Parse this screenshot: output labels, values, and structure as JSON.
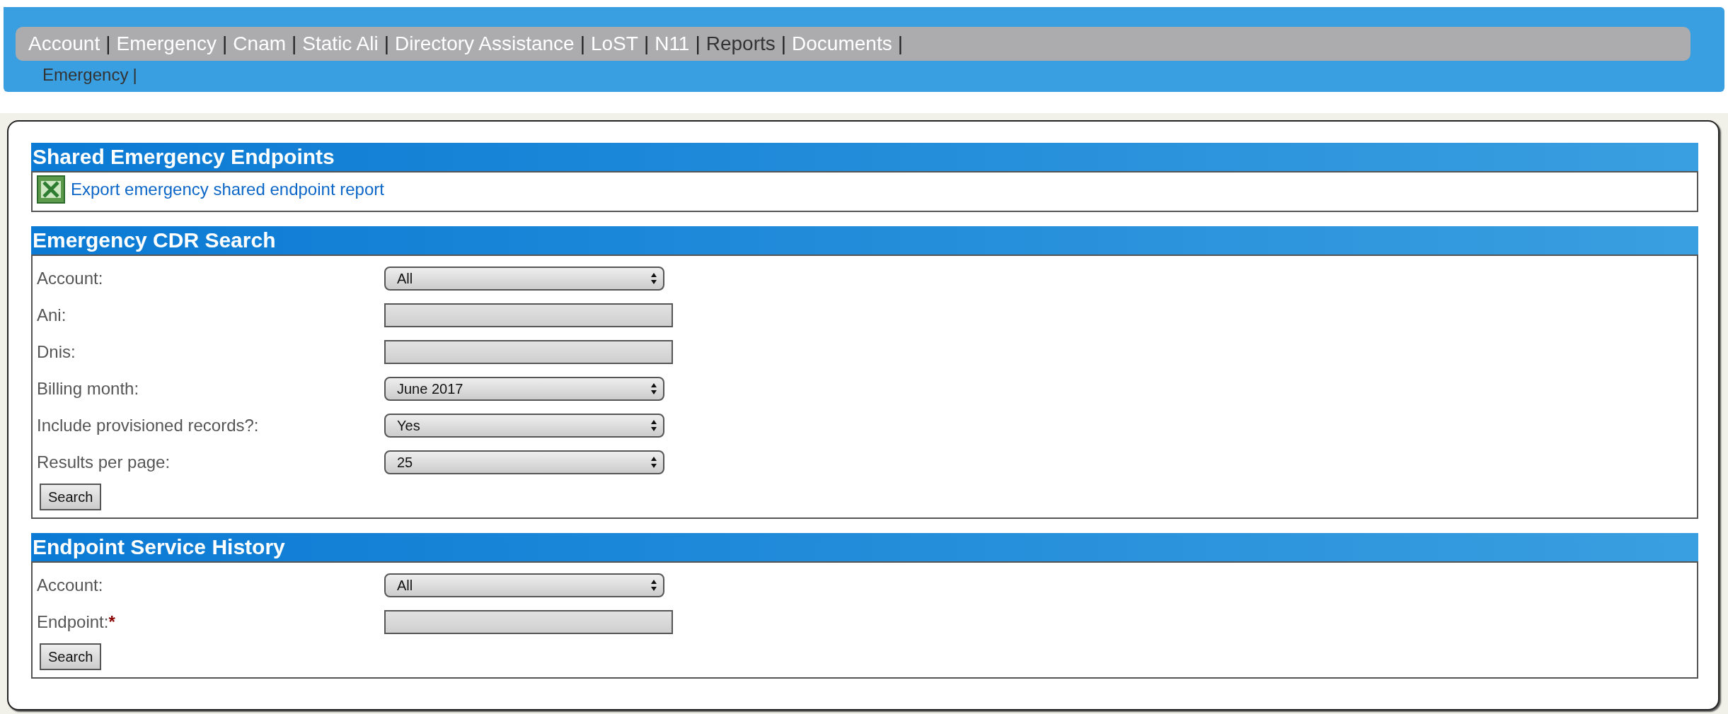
{
  "nav": {
    "separator": "|",
    "items": [
      {
        "label": "Account",
        "selected": false
      },
      {
        "label": "Emergency",
        "selected": false
      },
      {
        "label": "Cnam",
        "selected": false
      },
      {
        "label": "Static Ali",
        "selected": false
      },
      {
        "label": "Directory Assistance",
        "selected": false
      },
      {
        "label": "LoST",
        "selected": false
      },
      {
        "label": "N11",
        "selected": false
      },
      {
        "label": "Reports",
        "selected": true
      },
      {
        "label": "Documents",
        "selected": false
      }
    ],
    "subitems": [
      {
        "label": "Emergency",
        "selected": true
      }
    ]
  },
  "sections": [
    {
      "title": "Shared Emergency Endpoints",
      "kind": "links",
      "links": [
        {
          "label": "Export emergency shared endpoint report"
        }
      ]
    },
    {
      "title": "Emergency CDR Search",
      "kind": "form",
      "button": "Search",
      "fields": [
        {
          "kind": "select",
          "label": "Account:",
          "value": "All"
        },
        {
          "kind": "text",
          "label": "Ani:"
        },
        {
          "kind": "text",
          "label": "Dnis:"
        },
        {
          "kind": "select",
          "label": "Billing month:",
          "value": "June 2017"
        },
        {
          "kind": "select",
          "label": "Include provisioned records?:",
          "value": "Yes"
        },
        {
          "kind": "select",
          "label": "Results per page:",
          "value": "25"
        }
      ]
    },
    {
      "title": "Endpoint Service History",
      "kind": "form",
      "button": "Search",
      "fields": [
        {
          "kind": "select",
          "label": "Account:",
          "value": "All"
        },
        {
          "kind": "text",
          "label": "Endpoint:",
          "required_mark": "*"
        }
      ]
    }
  ]
}
